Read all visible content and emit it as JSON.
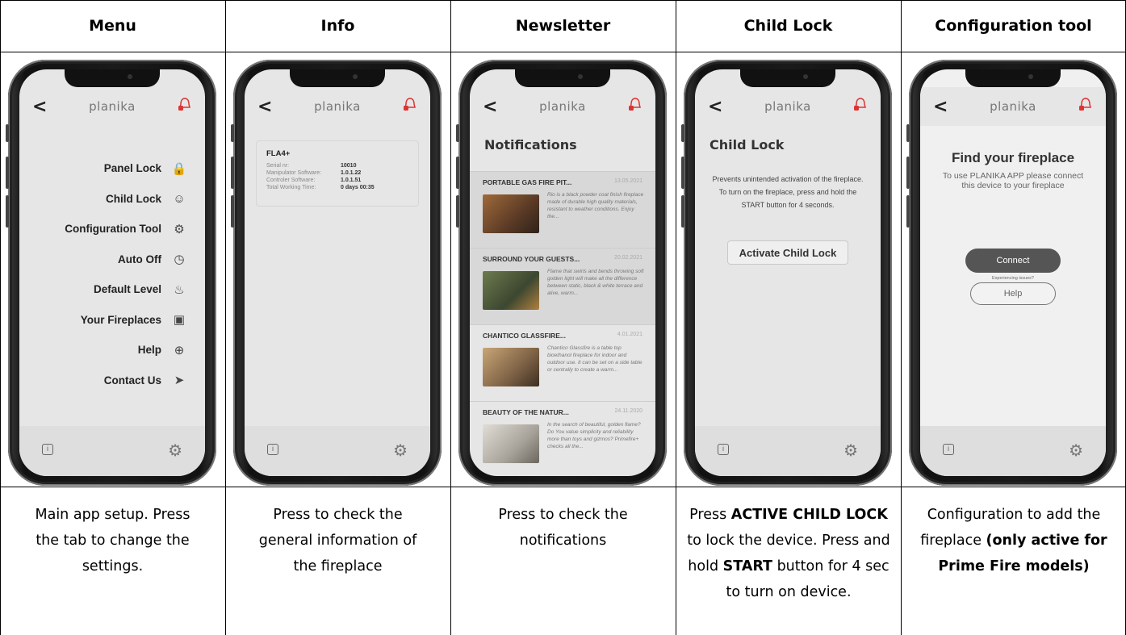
{
  "columns": [
    {
      "header": "Menu",
      "description_lines": [
        "Main app setup. Press",
        "the tab to change the",
        "settings."
      ]
    },
    {
      "header": "Info",
      "description_lines": [
        "Press to check the",
        "general information of",
        "the fireplace"
      ]
    },
    {
      "header": "Newsletter",
      "description_lines": [
        "Press to check the",
        "notifications"
      ]
    },
    {
      "header": "Child Lock",
      "description_parts": [
        {
          "t": "Press ",
          "b": false
        },
        {
          "t": "ACTIVE CHILD LOCK",
          "b": true
        },
        {
          "t": " to lock the device. Press and hold ",
          "b": false
        },
        {
          "t": "START",
          "b": true
        },
        {
          "t": " button for 4 sec to turn on device.",
          "b": false
        }
      ]
    },
    {
      "header": "Configuration tool",
      "description_parts": [
        {
          "t": "Configuration to add the fireplace ",
          "b": false
        },
        {
          "t": "(only active for Prime Fire models)",
          "b": true
        }
      ]
    }
  ],
  "app": {
    "brand": "planika",
    "back_glyph": "<",
    "info_glyph": "i",
    "settings_glyph": "⚙"
  },
  "menu_items": [
    {
      "label": "Panel Lock",
      "icon": "lock-icon",
      "glyph": "🔒"
    },
    {
      "label": "Child Lock",
      "icon": "child-face-icon",
      "glyph": "☺"
    },
    {
      "label": "Configuration Tool",
      "icon": "toggle-icon",
      "glyph": "⚙"
    },
    {
      "label": "Auto Off",
      "icon": "clock-icon",
      "glyph": "◷"
    },
    {
      "label": "Default Level",
      "icon": "flame-icon",
      "glyph": "♨"
    },
    {
      "label": "Your Fireplaces",
      "icon": "fireplace-icon",
      "glyph": "▣"
    },
    {
      "label": "Help",
      "icon": "lifebuoy-icon",
      "glyph": "⊕"
    },
    {
      "label": "Contact Us",
      "icon": "send-icon",
      "glyph": "➤"
    }
  ],
  "info": {
    "model": "FLA4+",
    "rows": [
      {
        "k": "Serial nr:",
        "v": "10010"
      },
      {
        "k": "Manipulator Software:",
        "v": "1.0.1.22"
      },
      {
        "k": "Controler Software:",
        "v": "1.0.1.51"
      },
      {
        "k": "Total Working Time:",
        "v": "0 days  00:35"
      }
    ]
  },
  "newsletter": {
    "title": "Notifications",
    "items": [
      {
        "title": "PORTABLE GAS FIRE PIT...",
        "date": "13.05.2021",
        "text": "Rio is a black powder coat finish fireplace made of durable high quality materials, resistant to weather conditions. Enjoy the...",
        "color": "#6b4a33"
      },
      {
        "title": "SURROUND YOUR GUESTS...",
        "date": "20.02.2021",
        "text": "Flame that swirls and bends throwing soft golden light will make all the difference between static, black & white terrace and alive, warm...",
        "color": "#4d5b3e"
      },
      {
        "title": "CHANTICO GLASSFIRE...",
        "date": "4.01.2021",
        "text": "Chantico Glassfire is a table top bioethanol fireplace for indoor and outdoor use. It can be set on a side table or centrally to create a warm...",
        "color": "#8a6f52"
      },
      {
        "title": "BEAUTY OF THE NATUR...",
        "date": "24.11.2020",
        "text": "In the search of beautiful, golden flame? Do You value simplicity and reliability more than toys and gizmos? Primefire+ checks all the...",
        "color": "#b9b4ac"
      }
    ]
  },
  "child_lock": {
    "title": "Child Lock",
    "text": "Prevents unintended activation of the fireplace. To turn on the fireplace, press and hold the START button for 4 seconds.",
    "button": "Activate Child Lock"
  },
  "config": {
    "title": "Find your fireplace",
    "text": "To use PLANIKA APP please connect this device to your fireplace",
    "connect": "Connect",
    "issues": "Experiencing issues?",
    "help": "Help"
  }
}
